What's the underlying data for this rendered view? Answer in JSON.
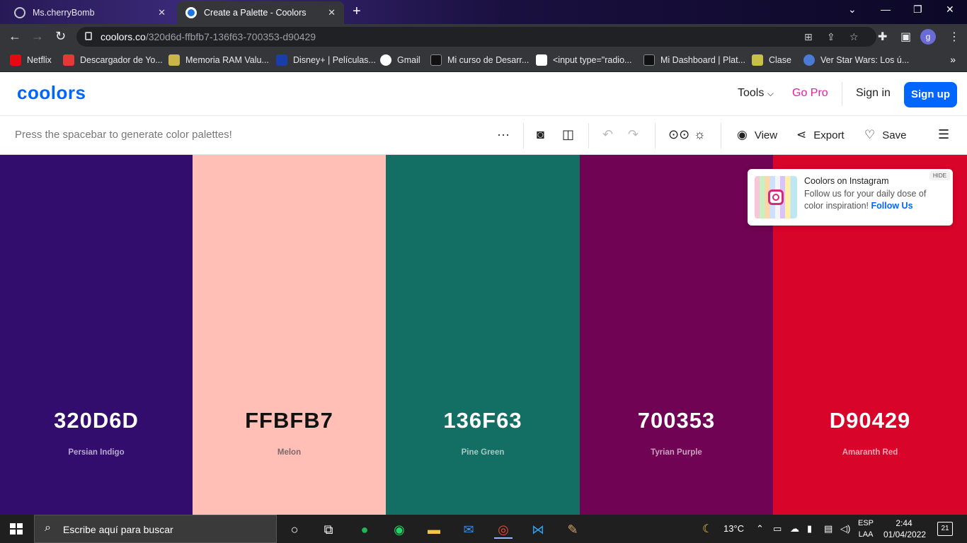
{
  "browser": {
    "tabs": [
      {
        "title": "Ms.cherryBomb",
        "close": "✕"
      },
      {
        "title": "Create a Palette - Coolors",
        "close": "✕"
      }
    ],
    "new_tab": "+",
    "url_host": "coolors.co",
    "url_path": "/320d6d-ffbfb7-136f63-700353-d90429",
    "profile_initial": "g",
    "bookmarks": [
      {
        "label": "Netflix",
        "color": "#e50914"
      },
      {
        "label": "Descargador de Yo...",
        "color": "#e53935"
      },
      {
        "label": "Memoria RAM Valu...",
        "color": "#c9b54a"
      },
      {
        "label": "Disney+ | Películas...",
        "color": "#1a3ea8"
      },
      {
        "label": "Gmail",
        "color": "#ffffff"
      },
      {
        "label": "Mi curso de Desarr...",
        "color": "#222222"
      },
      {
        "label": "<input type=\"radio...",
        "color": "#ffffff"
      },
      {
        "label": "Mi Dashboard | Plat...",
        "color": "#222222"
      },
      {
        "label": "Clase",
        "color": "#c9c04a"
      },
      {
        "label": "Ver Star Wars: Los ú...",
        "color": "#4a7bd6"
      }
    ],
    "bookmarks_more": "»"
  },
  "site": {
    "logo": "coolors",
    "nav_tools": "Tools",
    "nav_gopro": "Go Pro",
    "nav_signin": "Sign in",
    "nav_signup": "Sign up",
    "hint": "Press the spacebar to generate color palettes!",
    "view_label": "View",
    "export_label": "Export",
    "save_label": "Save"
  },
  "palette": [
    {
      "hex": "320D6D",
      "name": "Persian Indigo",
      "color": "#320d6d",
      "text_color": "#ffffff",
      "name_color": "#b7a9d0"
    },
    {
      "hex": "FFBFB7",
      "name": "Melon",
      "color": "#ffbfb7",
      "text_color": "#111111",
      "name_color": "#7a6a68"
    },
    {
      "hex": "136F63",
      "name": "Pine Green",
      "color": "#136f63",
      "text_color": "#ffffff",
      "name_color": "#a9c8c3"
    },
    {
      "hex": "700353",
      "name": "Tyrian Purple",
      "color": "#700353",
      "text_color": "#ffffff",
      "name_color": "#c9a3bf"
    },
    {
      "hex": "D90429",
      "name": "Amaranth Red",
      "color": "#d90429",
      "text_color": "#ffffff",
      "name_color": "#f0a8b3"
    }
  ],
  "instagram_popup": {
    "title": "Coolors on Instagram",
    "text": "Follow us for your daily dose of color inspiration!",
    "link": "Follow Us",
    "hide": "HIDE"
  },
  "taskbar": {
    "search_placeholder": "Escribe aquí para buscar",
    "weather": "13°C",
    "lang_line1": "ESP",
    "lang_line2": "LAA",
    "time": "2:44",
    "date": "01/04/2022",
    "notifications": "21"
  }
}
